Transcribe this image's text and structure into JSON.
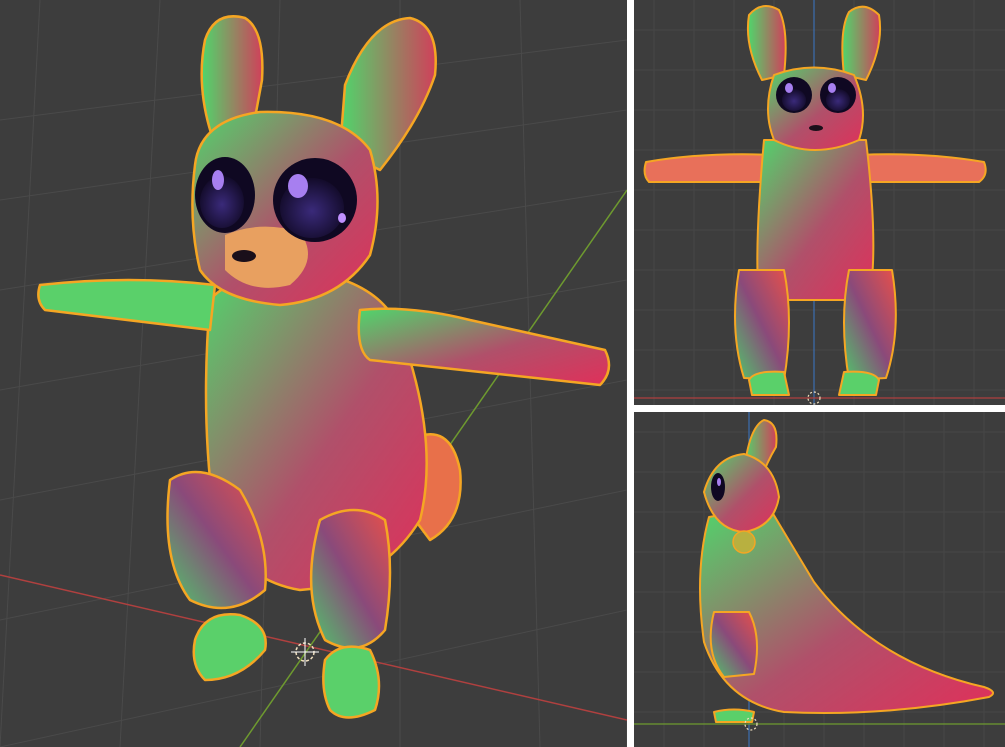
{
  "scene": {
    "colors": {
      "background": "#3d3d3d",
      "grid": "#4a4a4a",
      "separator": "#ffffff",
      "x_axis": "#b0403f",
      "y_axis": "#6e9a2f",
      "z_axis": "#3b6fb0",
      "outline": "#f5a623",
      "body_green": "#4fd66b",
      "body_red": "#e0305a",
      "body_purple": "#6a4a8a",
      "eye_dark": "#1a0f3a",
      "eye_iris": "#3a2a7a",
      "eye_highlight": "#a77ff0"
    },
    "viewports": [
      {
        "id": "perspective",
        "object": "cartoon-rabbit-creature"
      },
      {
        "id": "front",
        "object": "cartoon-rabbit-creature"
      },
      {
        "id": "side",
        "object": "cartoon-rabbit-creature"
      }
    ]
  }
}
